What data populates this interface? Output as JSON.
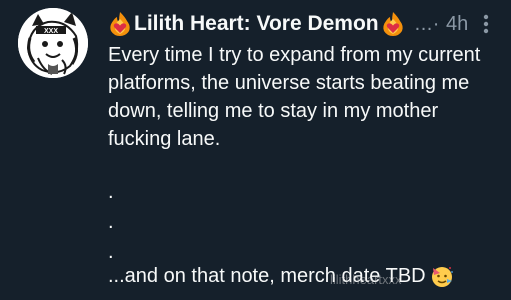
{
  "tweet": {
    "display_name": "Lilith Heart: Vore Demon",
    "meta_ellipsis": "...·",
    "time": "4h",
    "body_text": "Every time I try to expand from my current platforms, the universe starts beating me down, telling me to stay in my mother fucking lane.",
    "dots": [
      ".",
      ".",
      "."
    ],
    "closing_text": "...and on that note, merch date TBD",
    "avatar_icon": "cartoon-character-avatar-icon",
    "name_emoji": "fire-heart-icon",
    "closing_emoji": "party-face-icon",
    "more_icon": "vertical-ellipsis-icon"
  },
  "watermark": "lilithheartxxx",
  "colors": {
    "background": "#15202b",
    "text_primary": "#f7f9f9",
    "text_secondary": "#8b98a5"
  }
}
